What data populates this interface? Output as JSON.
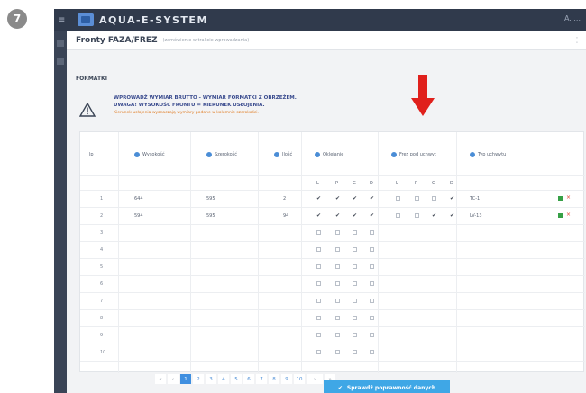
{
  "step": "7",
  "app": {
    "name": "AQUA-E-SYSTEM",
    "user": "A. ..."
  },
  "page": {
    "title": "Fronty FAZA/FREZ",
    "subtitle": "(zamówienie w trakcie wprowadzania)"
  },
  "section": "FORMATKI",
  "warning": {
    "line1": "WPROWADŹ WYMIAR BRUTTO - WYMIAR FORMATKI Z OBRZEŻEM.",
    "line2": "UWAGA! WYSOKOŚĆ FRONTU = KIERUNEK USŁOJENIA.",
    "line3": "Kierunek usłojenia wyznaczają wymiary podane w kolumnie szerokości."
  },
  "table": {
    "headers": {
      "lp": "lp",
      "height": "Wysokość",
      "width": "Szerokość",
      "qty": "Ilość",
      "edging": "Oklejanie",
      "frez": "Frez pod uchwyt",
      "handle_type": "Typ uchwytu"
    },
    "edging_sub": [
      "L",
      "P",
      "G",
      "D"
    ],
    "frez_sub": [
      "L",
      "P",
      "G",
      "D"
    ],
    "rows": [
      {
        "lp": "1",
        "height": "644",
        "width": "595",
        "qty": "2",
        "edging": [
          true,
          true,
          true,
          true
        ],
        "frez": [
          false,
          false,
          false,
          true
        ],
        "handle": "TC-1",
        "actions": true
      },
      {
        "lp": "2",
        "height": "594",
        "width": "595",
        "qty": "94",
        "edging": [
          true,
          true,
          true,
          true
        ],
        "frez": [
          false,
          false,
          true,
          true
        ],
        "handle": "LV-13",
        "actions": true
      },
      {
        "lp": "3",
        "height": "",
        "width": "",
        "qty": "",
        "edging": [
          false,
          false,
          false,
          false
        ],
        "frez": null,
        "handle": "",
        "actions": false
      },
      {
        "lp": "4",
        "height": "",
        "width": "",
        "qty": "",
        "edging": [
          false,
          false,
          false,
          false
        ],
        "frez": null,
        "handle": "",
        "actions": false
      },
      {
        "lp": "5",
        "height": "",
        "width": "",
        "qty": "",
        "edging": [
          false,
          false,
          false,
          false
        ],
        "frez": null,
        "handle": "",
        "actions": false
      },
      {
        "lp": "6",
        "height": "",
        "width": "",
        "qty": "",
        "edging": [
          false,
          false,
          false,
          false
        ],
        "frez": null,
        "handle": "",
        "actions": false
      },
      {
        "lp": "7",
        "height": "",
        "width": "",
        "qty": "",
        "edging": [
          false,
          false,
          false,
          false
        ],
        "frez": null,
        "handle": "",
        "actions": false
      },
      {
        "lp": "8",
        "height": "",
        "width": "",
        "qty": "",
        "edging": [
          false,
          false,
          false,
          false
        ],
        "frez": null,
        "handle": "",
        "actions": false
      },
      {
        "lp": "9",
        "height": "",
        "width": "",
        "qty": "",
        "edging": [
          false,
          false,
          false,
          false
        ],
        "frez": null,
        "handle": "",
        "actions": false
      },
      {
        "lp": "10",
        "height": "",
        "width": "",
        "qty": "",
        "edging": [
          false,
          false,
          false,
          false
        ],
        "frez": null,
        "handle": "",
        "actions": false
      }
    ]
  },
  "pagination": {
    "first": "«",
    "prev": "‹",
    "pages": [
      "1",
      "2",
      "3",
      "4",
      "5",
      "6",
      "7",
      "8",
      "9",
      "10"
    ],
    "active": "1",
    "next": "›",
    "last": "»"
  },
  "submit_label": "Sprawdź poprawność danych",
  "colors": {
    "accent": "#3f8fe0",
    "topbar": "#303a4c",
    "arrow": "#e0201c",
    "warning_text": "#3b4c8f",
    "warning_sub": "#e07a20"
  }
}
